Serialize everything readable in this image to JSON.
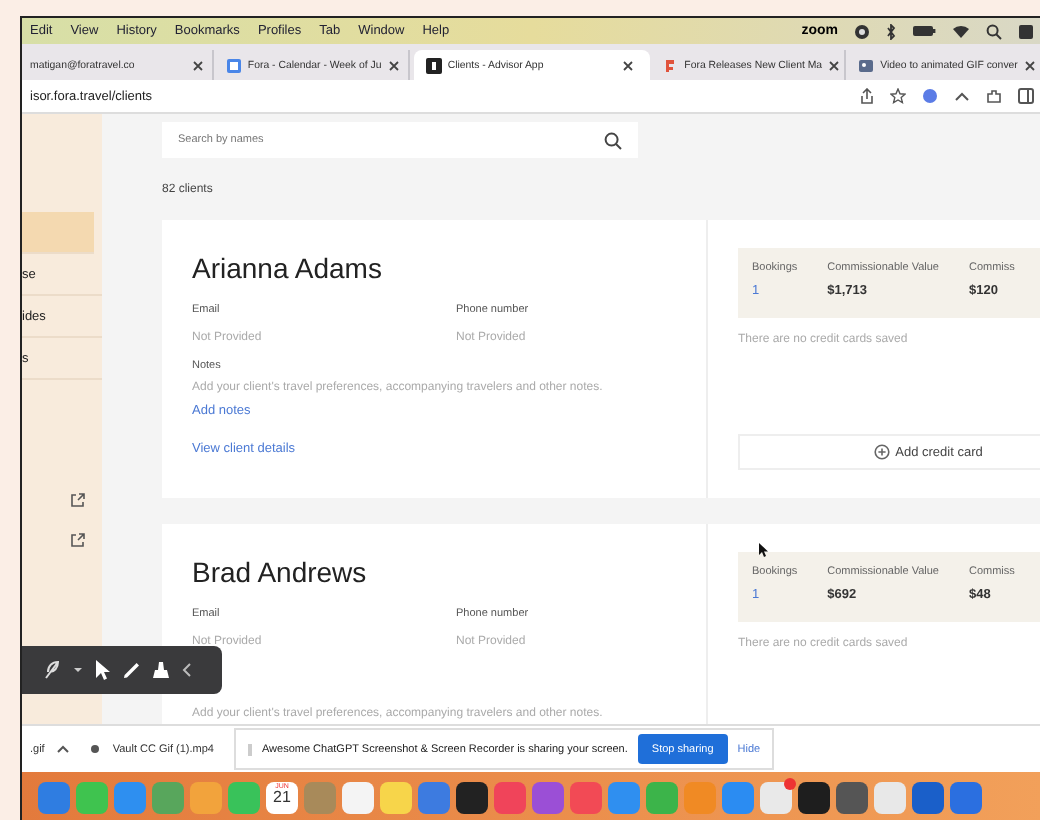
{
  "menu_bar": {
    "items": [
      "Edit",
      "View",
      "History",
      "Bookmarks",
      "Profiles",
      "Tab",
      "Window",
      "Help"
    ],
    "status_app": "zoom"
  },
  "tabs": [
    {
      "title": "matigan@foratravel.co",
      "selected": false,
      "kind": "plain"
    },
    {
      "title": "Fora - Calendar - Week of Ju",
      "selected": false,
      "kind": "calendar"
    },
    {
      "title": "Clients - Advisor App",
      "selected": true,
      "kind": "app"
    },
    {
      "title": "Fora Releases New Client Ma",
      "selected": false,
      "kind": "news"
    },
    {
      "title": "Video to animated GIF conver",
      "selected": false,
      "kind": "video"
    }
  ],
  "address_bar": {
    "url": "isor.fora.travel/clients"
  },
  "sidebar": {
    "items": [
      {
        "kind": "blank",
        "selected": true
      },
      {
        "kind": "text",
        "label": "se",
        "selected": false
      },
      {
        "kind": "text",
        "label": "ides",
        "selected": false
      },
      {
        "kind": "text",
        "label": "s",
        "selected": false
      },
      {
        "kind": "link",
        "selected": false
      },
      {
        "kind": "link",
        "selected": false
      }
    ]
  },
  "search": {
    "placeholder": "Search by names"
  },
  "client_count": "82 clients",
  "clients": [
    {
      "name": "Arianna Adams",
      "email_label": "Email",
      "email": "Not Provided",
      "phone_label": "Phone number",
      "phone": "Not Provided",
      "notes_label": "Notes",
      "notes_hint": "Add your client's travel preferences, accompanying travelers and other notes.",
      "add_notes": "Add notes",
      "view_details": "View client details",
      "stats": [
        {
          "label": "Bookings",
          "value": "1",
          "kind": "link"
        },
        {
          "label": "Commissionable Value",
          "value": "$1,713",
          "kind": "money"
        },
        {
          "label": "Commiss",
          "value": "$120",
          "kind": "money"
        }
      ],
      "credit_cards": "There are no credit cards saved",
      "add_card": "Add credit card"
    },
    {
      "name": "Brad Andrews",
      "email_label": "Email",
      "email": "Not Provided",
      "phone_label": "Phone number",
      "phone": "Not Provided",
      "notes_hint": "Add your client's travel preferences, accompanying travelers and other notes.",
      "stats": [
        {
          "label": "Bookings",
          "value": "1",
          "kind": "link"
        },
        {
          "label": "Commissionable Value",
          "value": "$692",
          "kind": "money"
        },
        {
          "label": "Commiss",
          "value": "$48",
          "kind": "money"
        }
      ],
      "credit_cards": "There are no credit cards saved"
    }
  ],
  "downloads": [
    {
      "name": ".gif",
      "kind": "image"
    },
    {
      "name": "Vault CC Gif (1).mp4",
      "kind": "video"
    }
  ],
  "share_notice": {
    "message": "Awesome ChatGPT Screenshot & Screen Recorder is sharing your screen.",
    "stop": "Stop sharing",
    "hide": "Hide"
  },
  "dock": [
    {
      "color": "#2f7de1"
    },
    {
      "color": "#3fc34f"
    },
    {
      "color": "#2e8ff0"
    },
    {
      "color": "#58a65c"
    },
    {
      "color": "#f2a33c"
    },
    {
      "color": "#39c25a"
    },
    {
      "kind": "calendar",
      "month": "JUN",
      "day": "21"
    },
    {
      "color": "#a88a5a"
    },
    {
      "color": "#f4f4f4"
    },
    {
      "color": "#f7d54a"
    },
    {
      "color": "#3d7be0"
    },
    {
      "color": "#222222"
    },
    {
      "color": "#f0445a"
    },
    {
      "color": "#9b4fd6"
    },
    {
      "color": "#f24a55"
    },
    {
      "color": "#2f8ff0"
    },
    {
      "color": "#3cb44a"
    },
    {
      "color": "#f08a24"
    },
    {
      "color": "#2b8cf2"
    },
    {
      "color": "#e9e9e9",
      "badge": true
    },
    {
      "color": "#1e1e1e"
    },
    {
      "color": "#555555"
    },
    {
      "color": "#e8e8e8"
    },
    {
      "color": "#1a5fc9"
    },
    {
      "color": "#2b6fe0"
    }
  ]
}
